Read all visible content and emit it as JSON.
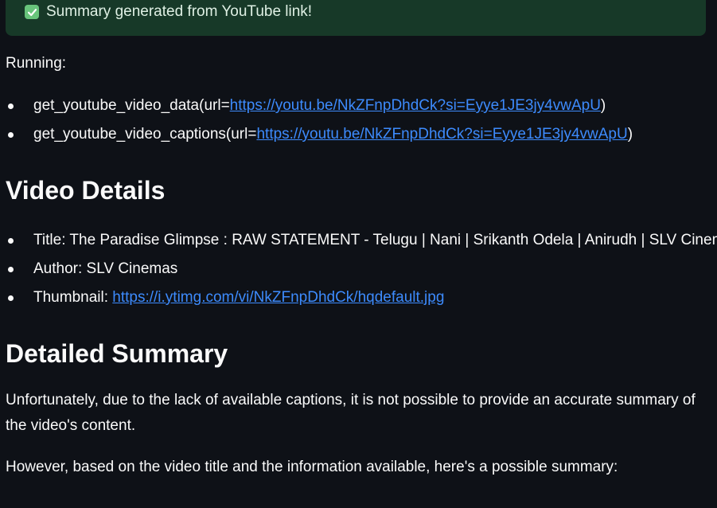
{
  "banner": {
    "text": "Summary generated from YouTube link!",
    "icon": "check-icon",
    "color": "#173928"
  },
  "running": {
    "label": "Running:",
    "items": [
      {
        "prefix": "get_youtube_video_data(url=",
        "link": "https://youtu.be/NkZFnpDhdCk?si=Eyye1JE3jy4vwApU",
        "suffix": ")"
      },
      {
        "prefix": "get_youtube_video_captions(url=",
        "link": "https://youtu.be/NkZFnpDhdCk?si=Eyye1JE3jy4vwApU",
        "suffix": ")"
      }
    ]
  },
  "video_details": {
    "heading": "Video Details",
    "title_label": "Title: ",
    "title_value": "The Paradise Glimpse : RAW STATEMENT - Telugu | Nani | Srikanth Odela | Anirudh | SLV Cinemas",
    "author_label": "Author: ",
    "author_value": "SLV Cinemas",
    "thumbnail_label": "Thumbnail: ",
    "thumbnail_link": "https://i.ytimg.com/vi/NkZFnpDhdCk/hqdefault.jpg"
  },
  "summary": {
    "heading": "Detailed Summary",
    "paragraph1": "Unfortunately, due to the lack of available captions, it is not possible to provide an accurate summary of the video's content.",
    "paragraph2": "However, based on the video title and the information available, here's a possible summary:"
  },
  "colors": {
    "background": "#0e1117",
    "link": "#3d8bfd",
    "success": "#68c47b"
  }
}
